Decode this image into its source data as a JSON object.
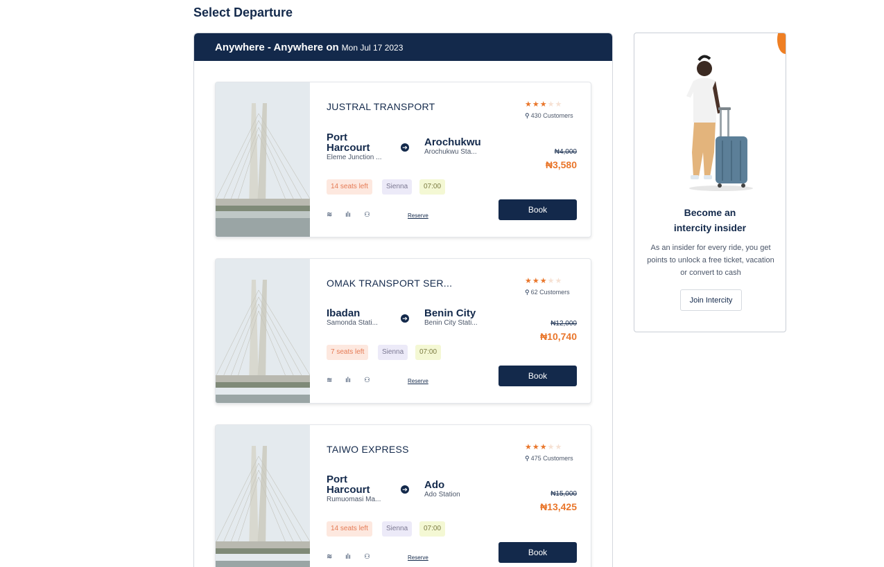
{
  "page": {
    "title": "Select Departure"
  },
  "search": {
    "route": "Anywhere - Anywhere on",
    "date": "Mon Jul 17 2023"
  },
  "trips": [
    {
      "operator": "JUSTRAL TRANSPORT",
      "rating": 3,
      "rating_max": 5,
      "customers": "430 Customers",
      "from_city": "Port Harcourt",
      "from_station": "Eleme Junction ...",
      "to_city": "Arochukwu",
      "to_station": "Arochukwu Sta...",
      "old_price": "₦4,000",
      "price": "₦3,580",
      "seats": "14 seats left",
      "vehicle": "Sienna",
      "time": "07:00",
      "reserve": "Reserve",
      "book": "Book"
    },
    {
      "operator": "OMAK TRANSPORT SER...",
      "rating": 3,
      "rating_max": 5,
      "customers": "62 Customers",
      "from_city": "Ibadan",
      "from_station": "Samonda Stati...",
      "to_city": "Benin City",
      "to_station": "Benin City Stati...",
      "old_price": "₦12,000",
      "price": "₦10,740",
      "seats": "7 seats left",
      "vehicle": "Sienna",
      "time": "07:00",
      "reserve": "Reserve",
      "book": "Book"
    },
    {
      "operator": "TAIWO EXPRESS",
      "rating": 3,
      "rating_max": 5,
      "customers": "475 Customers",
      "from_city": "Port Harcourt",
      "from_station": "Rumuomasi Ma...",
      "to_city": "Ado",
      "to_station": "Ado Station",
      "old_price": "₦15,000",
      "price": "₦13,425",
      "seats": "14 seats left",
      "vehicle": "Sienna",
      "time": "07:00",
      "reserve": "Reserve",
      "book": "Book"
    }
  ],
  "amenity_icons": [
    "wifi-icon",
    "sound-icon",
    "charging-icon"
  ],
  "insider": {
    "title_line1": "Become an",
    "title_line2": "intercity insider",
    "text": "As an insider for every ride, you get points to unlock a free ticket, vacation or convert to cash",
    "button": "Join Intercity"
  },
  "colors": {
    "navy": "#13294b",
    "accent": "#e9762b"
  }
}
